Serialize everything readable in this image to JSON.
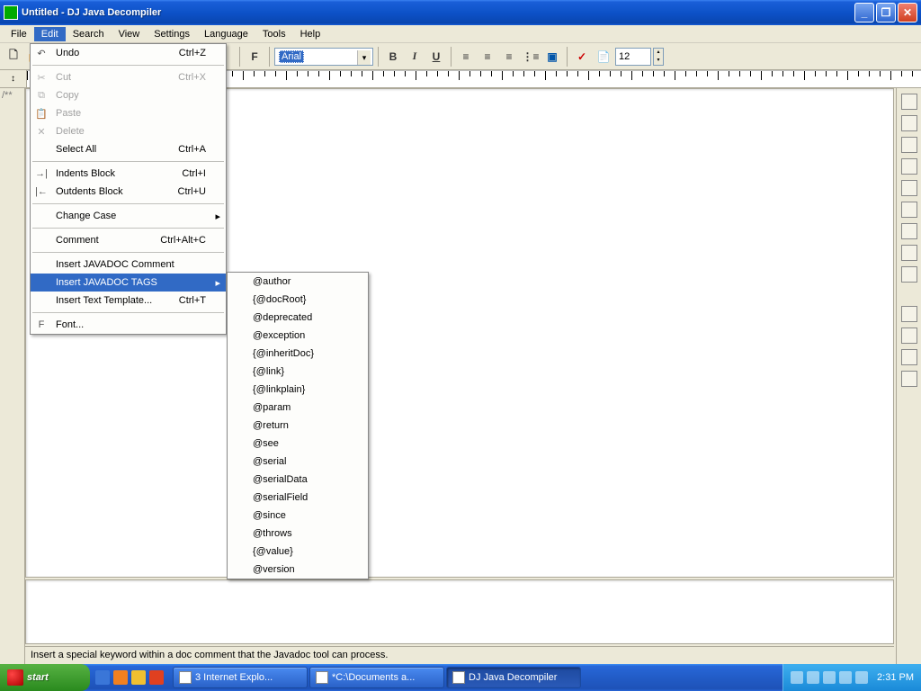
{
  "window": {
    "title": "Untitled - DJ Java Decompiler"
  },
  "menubar": [
    "File",
    "Edit",
    "Search",
    "View",
    "Settings",
    "Language",
    "Tools",
    "Help"
  ],
  "menubar_open_index": 1,
  "toolbar": {
    "f_label": "F",
    "font_name": "Arial",
    "font_size": "12",
    "bold": "B",
    "italic": "I",
    "underline": "U"
  },
  "gutter": {
    "comment": "/**"
  },
  "edit_menu": [
    {
      "icon": "↶",
      "label": "Undo",
      "shortcut": "Ctrl+Z",
      "disabled": false
    },
    "---",
    {
      "icon": "✂",
      "label": "Cut",
      "shortcut": "Ctrl+X",
      "disabled": true
    },
    {
      "icon": "⧉",
      "label": "Copy",
      "shortcut": "",
      "disabled": true
    },
    {
      "icon": "📋",
      "label": "Paste",
      "shortcut": "",
      "disabled": true
    },
    {
      "icon": "✕",
      "label": "Delete",
      "shortcut": "",
      "disabled": true
    },
    {
      "icon": "",
      "label": "Select All",
      "shortcut": "Ctrl+A",
      "disabled": false
    },
    "---",
    {
      "icon": "→|",
      "label": "Indents Block",
      "shortcut": "Ctrl+I",
      "disabled": false
    },
    {
      "icon": "|←",
      "label": "Outdents Block",
      "shortcut": "Ctrl+U",
      "disabled": false
    },
    "---",
    {
      "icon": "",
      "label": "Change Case",
      "shortcut": "",
      "submenu": true,
      "disabled": false
    },
    "---",
    {
      "icon": "",
      "label": "Comment",
      "shortcut": "Ctrl+Alt+C",
      "disabled": false
    },
    "---",
    {
      "icon": "",
      "label": "Insert JAVADOC Comment",
      "shortcut": "",
      "disabled": false
    },
    {
      "icon": "",
      "label": "Insert JAVADOC TAGS",
      "shortcut": "",
      "submenu": true,
      "highlight": true,
      "disabled": false
    },
    {
      "icon": "",
      "label": "Insert Text Template...",
      "shortcut": "Ctrl+T",
      "disabled": false
    },
    "---",
    {
      "icon": "F",
      "label": "Font...",
      "shortcut": "",
      "disabled": false
    }
  ],
  "javadoc_tags": [
    "@author",
    "{@docRoot}",
    "@deprecated",
    "@exception",
    "{@inheritDoc}",
    "{@link}",
    "{@linkplain}",
    "@param",
    "@return",
    "@see",
    "@serial",
    "@serialData",
    "@serialField",
    "@since",
    "@throws",
    "{@value}",
    "@version"
  ],
  "statusbar": {
    "text": "Insert a special keyword within a doc comment that the Javadoc tool can process."
  },
  "taskbar": {
    "start": "start",
    "tasks": [
      {
        "label": "3 Internet Explo..."
      },
      {
        "label": "*C:\\Documents a..."
      },
      {
        "label": "DJ Java Decompiler",
        "active": true
      }
    ],
    "clock": "2:31 PM"
  }
}
